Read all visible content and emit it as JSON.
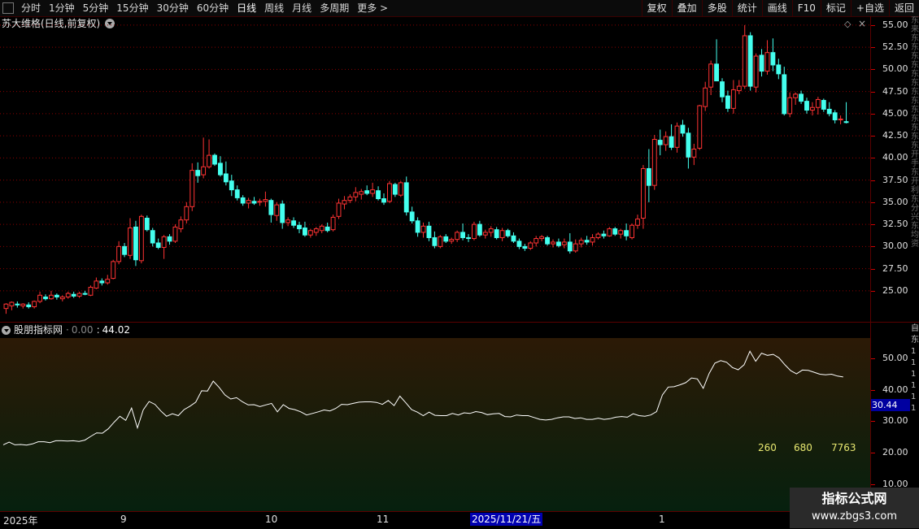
{
  "toolbar": {
    "periods": [
      "分时",
      "1分钟",
      "5分钟",
      "15分钟",
      "30分钟",
      "60分钟",
      "日线",
      "周线",
      "月线",
      "多周期",
      "更多 >"
    ],
    "active_period": "日线",
    "right_buttons": [
      "复权",
      "叠加",
      "多股",
      "统计",
      "画线",
      "F10",
      "标记",
      "+自选",
      "返回"
    ]
  },
  "main_title": "苏大维格(日线,前复权)",
  "indicator": {
    "name": "股朋指标网",
    "value_a": "0.00",
    "value_b": "44.02",
    "current_tag": "30.44",
    "stats": [
      "260",
      "680",
      "7763"
    ]
  },
  "side_strip_text": "东来东东东东东东东东东东东东东开手东开利东分兴东均资",
  "side_strip_values": [
    "自",
    "东",
    "1",
    "1",
    "1",
    "1",
    "1",
    "1"
  ],
  "xaxis": {
    "labels": [
      "2025年",
      "9",
      "10",
      "11",
      "1"
    ],
    "selected_date": "2025/11/21/五"
  },
  "watermark": {
    "line1": "指标公式网",
    "line2": "www.zbgs3.com"
  },
  "chart_data": [
    {
      "type": "candlestick",
      "title": "苏大维格(日线,前复权)",
      "y_ticks": [
        25.0,
        27.5,
        30.0,
        32.5,
        35.0,
        37.5,
        40.0,
        42.5,
        45.0,
        47.5,
        50.0,
        52.5,
        55.0
      ],
      "ylim": [
        21.5,
        56.0
      ],
      "colors": {
        "up": "#ff3333",
        "down": "#44ffee",
        "grid": "#8b0000"
      },
      "candles": [
        {
          "o": 23.0,
          "h": 23.6,
          "l": 22.4,
          "c": 23.5
        },
        {
          "o": 23.3,
          "h": 23.8,
          "l": 22.8,
          "c": 23.7
        },
        {
          "o": 23.5,
          "h": 23.8,
          "l": 23.1,
          "c": 23.4
        },
        {
          "o": 23.3,
          "h": 23.6,
          "l": 23.0,
          "c": 23.5
        },
        {
          "o": 23.4,
          "h": 23.7,
          "l": 23.0,
          "c": 23.2
        },
        {
          "o": 23.2,
          "h": 23.9,
          "l": 23.0,
          "c": 23.8
        },
        {
          "o": 23.8,
          "h": 24.9,
          "l": 23.6,
          "c": 24.5
        },
        {
          "o": 24.3,
          "h": 24.6,
          "l": 23.9,
          "c": 24.1
        },
        {
          "o": 24.1,
          "h": 25.0,
          "l": 24.0,
          "c": 24.5
        },
        {
          "o": 24.5,
          "h": 24.7,
          "l": 24.0,
          "c": 24.3
        },
        {
          "o": 24.1,
          "h": 24.5,
          "l": 23.8,
          "c": 24.3
        },
        {
          "o": 24.3,
          "h": 24.9,
          "l": 24.1,
          "c": 24.7
        },
        {
          "o": 24.6,
          "h": 24.9,
          "l": 24.2,
          "c": 24.4
        },
        {
          "o": 24.4,
          "h": 24.9,
          "l": 24.2,
          "c": 24.7
        },
        {
          "o": 24.7,
          "h": 25.0,
          "l": 24.5,
          "c": 24.6
        },
        {
          "o": 24.5,
          "h": 25.6,
          "l": 24.4,
          "c": 25.4
        },
        {
          "o": 25.3,
          "h": 26.5,
          "l": 25.2,
          "c": 26.1
        },
        {
          "o": 26.1,
          "h": 26.4,
          "l": 25.6,
          "c": 25.9
        },
        {
          "o": 25.9,
          "h": 26.8,
          "l": 25.7,
          "c": 26.3
        },
        {
          "o": 26.4,
          "h": 28.5,
          "l": 26.3,
          "c": 28.3
        },
        {
          "o": 28.3,
          "h": 30.6,
          "l": 28.0,
          "c": 30.0
        },
        {
          "o": 30.0,
          "h": 30.4,
          "l": 28.8,
          "c": 29.1
        },
        {
          "o": 29.0,
          "h": 33.2,
          "l": 28.6,
          "c": 32.1
        },
        {
          "o": 32.2,
          "h": 32.9,
          "l": 27.8,
          "c": 28.5
        },
        {
          "o": 28.4,
          "h": 33.6,
          "l": 28.1,
          "c": 33.4
        },
        {
          "o": 33.2,
          "h": 33.5,
          "l": 31.7,
          "c": 31.9
        },
        {
          "o": 31.8,
          "h": 32.1,
          "l": 30.0,
          "c": 30.4
        },
        {
          "o": 30.4,
          "h": 30.9,
          "l": 29.7,
          "c": 29.9
        },
        {
          "o": 29.9,
          "h": 31.3,
          "l": 28.6,
          "c": 31.1
        },
        {
          "o": 31.1,
          "h": 31.4,
          "l": 30.2,
          "c": 30.6
        },
        {
          "o": 30.6,
          "h": 32.5,
          "l": 30.4,
          "c": 32.2
        },
        {
          "o": 32.0,
          "h": 33.4,
          "l": 31.6,
          "c": 33.0
        },
        {
          "o": 33.0,
          "h": 35.0,
          "l": 32.6,
          "c": 34.5
        },
        {
          "o": 34.5,
          "h": 39.4,
          "l": 34.0,
          "c": 38.6
        },
        {
          "o": 38.6,
          "h": 39.5,
          "l": 37.2,
          "c": 38.0
        },
        {
          "o": 38.1,
          "h": 42.3,
          "l": 37.7,
          "c": 39.0
        },
        {
          "o": 39.0,
          "h": 42.1,
          "l": 38.8,
          "c": 40.3
        },
        {
          "o": 40.3,
          "h": 40.5,
          "l": 39.1,
          "c": 39.3
        },
        {
          "o": 39.4,
          "h": 40.2,
          "l": 37.9,
          "c": 38.1
        },
        {
          "o": 38.2,
          "h": 39.6,
          "l": 36.9,
          "c": 37.3
        },
        {
          "o": 37.4,
          "h": 38.1,
          "l": 35.7,
          "c": 36.4
        },
        {
          "o": 36.4,
          "h": 36.9,
          "l": 35.2,
          "c": 35.5
        },
        {
          "o": 35.5,
          "h": 35.8,
          "l": 34.6,
          "c": 34.9
        },
        {
          "o": 34.9,
          "h": 35.5,
          "l": 34.3,
          "c": 35.2
        },
        {
          "o": 35.1,
          "h": 35.6,
          "l": 34.7,
          "c": 34.9
        },
        {
          "o": 35.0,
          "h": 35.4,
          "l": 34.6,
          "c": 35.1
        },
        {
          "o": 35.1,
          "h": 36.2,
          "l": 34.5,
          "c": 35.3
        },
        {
          "o": 35.2,
          "h": 35.4,
          "l": 32.7,
          "c": 33.6
        },
        {
          "o": 33.5,
          "h": 35.0,
          "l": 32.9,
          "c": 34.7
        },
        {
          "o": 34.8,
          "h": 35.2,
          "l": 32.0,
          "c": 32.7
        },
        {
          "o": 32.7,
          "h": 33.3,
          "l": 32.3,
          "c": 33.0
        },
        {
          "o": 32.9,
          "h": 33.3,
          "l": 32.1,
          "c": 32.4
        },
        {
          "o": 32.4,
          "h": 32.8,
          "l": 31.5,
          "c": 32.0
        },
        {
          "o": 32.1,
          "h": 32.8,
          "l": 31.1,
          "c": 31.3
        },
        {
          "o": 31.3,
          "h": 32.0,
          "l": 31.0,
          "c": 31.8
        },
        {
          "o": 31.6,
          "h": 32.2,
          "l": 31.2,
          "c": 32.0
        },
        {
          "o": 31.8,
          "h": 32.5,
          "l": 31.5,
          "c": 32.3
        },
        {
          "o": 32.2,
          "h": 32.7,
          "l": 31.6,
          "c": 31.8
        },
        {
          "o": 31.9,
          "h": 33.6,
          "l": 31.7,
          "c": 33.3
        },
        {
          "o": 33.4,
          "h": 35.4,
          "l": 33.1,
          "c": 34.9
        },
        {
          "o": 34.8,
          "h": 35.7,
          "l": 34.2,
          "c": 35.2
        },
        {
          "o": 35.2,
          "h": 35.9,
          "l": 34.9,
          "c": 35.6
        },
        {
          "o": 35.6,
          "h": 36.7,
          "l": 35.1,
          "c": 36.1
        },
        {
          "o": 35.9,
          "h": 36.5,
          "l": 35.3,
          "c": 36.2
        },
        {
          "o": 36.3,
          "h": 36.9,
          "l": 35.8,
          "c": 36.0
        },
        {
          "o": 36.0,
          "h": 37.2,
          "l": 35.6,
          "c": 36.4
        },
        {
          "o": 36.3,
          "h": 36.8,
          "l": 35.2,
          "c": 35.4
        },
        {
          "o": 35.4,
          "h": 36.0,
          "l": 34.7,
          "c": 35.0
        },
        {
          "o": 35.1,
          "h": 37.4,
          "l": 34.9,
          "c": 37.1
        },
        {
          "o": 37.0,
          "h": 37.2,
          "l": 35.6,
          "c": 35.9
        },
        {
          "o": 35.8,
          "h": 37.4,
          "l": 35.6,
          "c": 37.2
        },
        {
          "o": 37.2,
          "h": 37.9,
          "l": 33.5,
          "c": 33.9
        },
        {
          "o": 33.9,
          "h": 34.5,
          "l": 32.6,
          "c": 32.9
        },
        {
          "o": 32.9,
          "h": 33.3,
          "l": 31.1,
          "c": 31.6
        },
        {
          "o": 31.6,
          "h": 32.7,
          "l": 31.0,
          "c": 32.3
        },
        {
          "o": 32.3,
          "h": 32.8,
          "l": 30.6,
          "c": 31.0
        },
        {
          "o": 31.0,
          "h": 31.7,
          "l": 29.8,
          "c": 30.1
        },
        {
          "o": 30.0,
          "h": 31.3,
          "l": 29.8,
          "c": 31.1
        },
        {
          "o": 31.1,
          "h": 31.4,
          "l": 30.4,
          "c": 30.6
        },
        {
          "o": 30.6,
          "h": 31.0,
          "l": 30.3,
          "c": 30.8
        },
        {
          "o": 30.8,
          "h": 31.8,
          "l": 30.5,
          "c": 31.6
        },
        {
          "o": 31.6,
          "h": 32.6,
          "l": 30.7,
          "c": 31.0
        },
        {
          "o": 31.0,
          "h": 31.4,
          "l": 30.5,
          "c": 30.9
        },
        {
          "o": 30.9,
          "h": 32.8,
          "l": 30.7,
          "c": 32.5
        },
        {
          "o": 32.5,
          "h": 32.9,
          "l": 31.1,
          "c": 31.3
        },
        {
          "o": 31.3,
          "h": 31.9,
          "l": 30.9,
          "c": 31.6
        },
        {
          "o": 31.6,
          "h": 32.3,
          "l": 31.1,
          "c": 32.0
        },
        {
          "o": 31.9,
          "h": 32.2,
          "l": 30.8,
          "c": 31.0
        },
        {
          "o": 31.0,
          "h": 32.1,
          "l": 30.6,
          "c": 31.8
        },
        {
          "o": 31.8,
          "h": 32.0,
          "l": 31.0,
          "c": 31.2
        },
        {
          "o": 31.2,
          "h": 31.6,
          "l": 30.4,
          "c": 30.6
        },
        {
          "o": 30.6,
          "h": 30.9,
          "l": 29.7,
          "c": 30.0
        },
        {
          "o": 30.0,
          "h": 30.3,
          "l": 29.5,
          "c": 29.8
        },
        {
          "o": 29.8,
          "h": 30.6,
          "l": 29.6,
          "c": 30.4
        },
        {
          "o": 30.4,
          "h": 31.2,
          "l": 30.0,
          "c": 30.9
        },
        {
          "o": 30.9,
          "h": 31.3,
          "l": 30.6,
          "c": 31.1
        },
        {
          "o": 31.0,
          "h": 31.2,
          "l": 30.1,
          "c": 30.3
        },
        {
          "o": 30.3,
          "h": 30.8,
          "l": 29.9,
          "c": 30.5
        },
        {
          "o": 30.5,
          "h": 30.9,
          "l": 29.9,
          "c": 30.1
        },
        {
          "o": 30.2,
          "h": 30.9,
          "l": 29.8,
          "c": 30.5
        },
        {
          "o": 30.5,
          "h": 31.5,
          "l": 29.2,
          "c": 29.5
        },
        {
          "o": 29.5,
          "h": 30.8,
          "l": 29.3,
          "c": 30.3
        },
        {
          "o": 30.3,
          "h": 31.0,
          "l": 29.9,
          "c": 30.7
        },
        {
          "o": 30.7,
          "h": 31.2,
          "l": 30.2,
          "c": 30.5
        },
        {
          "o": 30.5,
          "h": 31.4,
          "l": 30.1,
          "c": 31.0
        },
        {
          "o": 31.0,
          "h": 31.6,
          "l": 30.8,
          "c": 31.4
        },
        {
          "o": 31.4,
          "h": 31.8,
          "l": 30.9,
          "c": 31.2
        },
        {
          "o": 31.2,
          "h": 32.2,
          "l": 31.1,
          "c": 32.0
        },
        {
          "o": 32.0,
          "h": 32.2,
          "l": 31.2,
          "c": 31.4
        },
        {
          "o": 31.4,
          "h": 32.0,
          "l": 30.9,
          "c": 31.8
        },
        {
          "o": 31.8,
          "h": 32.6,
          "l": 30.7,
          "c": 31.2
        },
        {
          "o": 31.0,
          "h": 32.6,
          "l": 30.8,
          "c": 32.4
        },
        {
          "o": 32.4,
          "h": 33.6,
          "l": 32.0,
          "c": 33.1
        },
        {
          "o": 33.2,
          "h": 39.2,
          "l": 32.0,
          "c": 38.8
        },
        {
          "o": 38.8,
          "h": 41.0,
          "l": 35.0,
          "c": 36.9
        },
        {
          "o": 36.9,
          "h": 42.6,
          "l": 36.4,
          "c": 42.1
        },
        {
          "o": 42.0,
          "h": 43.2,
          "l": 40.3,
          "c": 41.5
        },
        {
          "o": 41.5,
          "h": 43.0,
          "l": 40.8,
          "c": 42.4
        },
        {
          "o": 42.4,
          "h": 43.8,
          "l": 40.9,
          "c": 41.2
        },
        {
          "o": 41.2,
          "h": 44.0,
          "l": 40.6,
          "c": 43.6
        },
        {
          "o": 43.7,
          "h": 44.3,
          "l": 42.4,
          "c": 42.8
        },
        {
          "o": 42.8,
          "h": 43.4,
          "l": 38.8,
          "c": 40.1
        },
        {
          "o": 40.1,
          "h": 41.6,
          "l": 39.2,
          "c": 41.0
        },
        {
          "o": 41.1,
          "h": 46.0,
          "l": 40.9,
          "c": 45.9
        },
        {
          "o": 45.8,
          "h": 48.6,
          "l": 45.3,
          "c": 47.9
        },
        {
          "o": 48.0,
          "h": 51.0,
          "l": 47.1,
          "c": 50.6
        },
        {
          "o": 50.6,
          "h": 53.4,
          "l": 49.1,
          "c": 48.7
        },
        {
          "o": 48.6,
          "h": 49.0,
          "l": 46.3,
          "c": 46.9
        },
        {
          "o": 47.0,
          "h": 47.6,
          "l": 45.2,
          "c": 45.6
        },
        {
          "o": 45.6,
          "h": 48.8,
          "l": 45.0,
          "c": 47.7
        },
        {
          "o": 47.6,
          "h": 48.8,
          "l": 47.2,
          "c": 48.1
        },
        {
          "o": 48.1,
          "h": 55.0,
          "l": 47.8,
          "c": 53.8
        },
        {
          "o": 53.8,
          "h": 54.2,
          "l": 47.6,
          "c": 48.1
        },
        {
          "o": 48.0,
          "h": 51.8,
          "l": 47.4,
          "c": 51.5
        },
        {
          "o": 51.6,
          "h": 52.3,
          "l": 49.2,
          "c": 49.8
        },
        {
          "o": 49.8,
          "h": 53.3,
          "l": 49.4,
          "c": 51.9
        },
        {
          "o": 51.9,
          "h": 53.5,
          "l": 49.8,
          "c": 50.5
        },
        {
          "o": 50.5,
          "h": 51.2,
          "l": 48.9,
          "c": 49.5
        },
        {
          "o": 49.4,
          "h": 50.3,
          "l": 44.8,
          "c": 45.0
        },
        {
          "o": 45.0,
          "h": 47.4,
          "l": 44.6,
          "c": 46.8
        },
        {
          "o": 46.8,
          "h": 47.4,
          "l": 46.0,
          "c": 47.2
        },
        {
          "o": 47.2,
          "h": 47.6,
          "l": 46.1,
          "c": 46.4
        },
        {
          "o": 46.4,
          "h": 46.8,
          "l": 45.0,
          "c": 45.4
        },
        {
          "o": 45.4,
          "h": 46.3,
          "l": 44.8,
          "c": 45.7
        },
        {
          "o": 45.7,
          "h": 46.9,
          "l": 44.9,
          "c": 46.6
        },
        {
          "o": 46.5,
          "h": 46.7,
          "l": 45.2,
          "c": 45.5
        },
        {
          "o": 45.5,
          "h": 46.3,
          "l": 44.7,
          "c": 45.0
        },
        {
          "o": 45.1,
          "h": 45.4,
          "l": 43.9,
          "c": 44.3
        },
        {
          "o": 44.3,
          "h": 44.8,
          "l": 43.8,
          "c": 44.4
        },
        {
          "o": 44.1,
          "h": 46.3,
          "l": 43.9,
          "c": 44.0
        }
      ]
    },
    {
      "type": "line",
      "title": "股朋指标网",
      "y_ticks": [
        10.0,
        20.0,
        30.0,
        40.0,
        50.0
      ],
      "ylim": [
        1.4,
        56.5
      ],
      "colors": {
        "line": "#ffffff",
        "bg_top": "#2c1a06",
        "bg_bottom": "#06200e"
      },
      "values": [
        22.5,
        23.4,
        22.5,
        22.6,
        22.4,
        22.8,
        23.5,
        23.5,
        23.2,
        23.8,
        23.8,
        23.7,
        23.8,
        23.6,
        24.0,
        25.2,
        26.3,
        26.2,
        27.6,
        29.7,
        31.6,
        30.3,
        34.2,
        27.9,
        33.6,
        36.3,
        35.4,
        33.3,
        31.6,
        32.4,
        31.8,
        33.7,
        34.8,
        36.1,
        39.7,
        39.6,
        42.8,
        40.8,
        38.4,
        37.1,
        37.5,
        36.2,
        35.2,
        35.3,
        34.7,
        35.2,
        35.7,
        33.0,
        35.3,
        34.1,
        33.7,
        33.0,
        32.0,
        32.5,
        33.0,
        33.6,
        33.3,
        34.1,
        35.4,
        35.3,
        35.7,
        36.1,
        36.2,
        36.2,
        36.0,
        35.4,
        36.6,
        35.0,
        38.0,
        35.9,
        33.7,
        32.9,
        31.8,
        32.9,
        31.9,
        31.8,
        31.8,
        32.5,
        32.0,
        32.7,
        32.5,
        33.1,
        32.8,
        32.1,
        32.4,
        32.5,
        31.5,
        31.4,
        32.0,
        31.8,
        31.8,
        31.2,
        30.6,
        30.4,
        30.6,
        31.1,
        31.4,
        31.4,
        30.9,
        31.1,
        30.6,
        30.6,
        31.0,
        30.6,
        30.8,
        31.3,
        31.5,
        31.3,
        32.4,
        31.8,
        31.6,
        32.0,
        33.1,
        38.4,
        40.9,
        41.0,
        41.6,
        42.3,
        43.8,
        43.5,
        40.5,
        45.2,
        48.5,
        49.3,
        48.8,
        47.1,
        46.4,
        48.0,
        52.3,
        49.1,
        51.7,
        51.0,
        51.3,
        50.2,
        48.0,
        46.1,
        45.1,
        46.3,
        46.2,
        45.6,
        45.0,
        44.8,
        45.0,
        44.4,
        44.1
      ]
    }
  ]
}
